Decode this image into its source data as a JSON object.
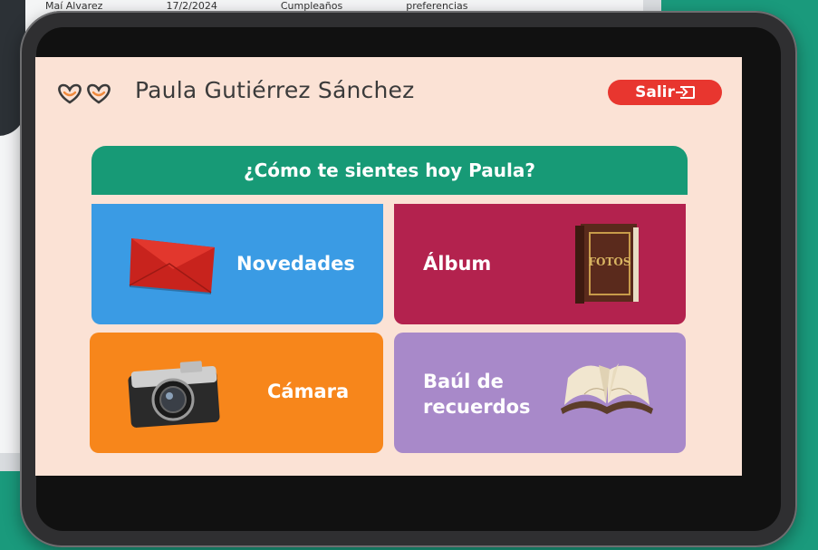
{
  "background_device": {
    "row": [
      "Maí Alvarez",
      "17/2/2024",
      "Cumpleaños",
      "preferencias"
    ]
  },
  "app": {
    "user_name": "Paula Gutiérrez Sánchez",
    "logout_label": "Salir",
    "question": "¿Cómo te sientes hoy Paula?"
  },
  "tiles": [
    {
      "id": "news",
      "label": "Novedades",
      "icon": "envelope-icon",
      "color": "#3a9be4"
    },
    {
      "id": "album",
      "label": "Álbum",
      "icon": "photo-album-icon",
      "color": "#b3224e",
      "icon_text": "FOTOS"
    },
    {
      "id": "camera",
      "label": "Cámara",
      "icon": "camera-icon",
      "color": "#f7861b"
    },
    {
      "id": "memories",
      "label_line1": "Baúl de",
      "label_line2": "recuerdos",
      "icon": "open-book-icon",
      "color": "#a889c9"
    }
  ],
  "colors": {
    "page_background": "#1a9a7c",
    "screen_background": "#fbe2d5",
    "banner": "#179a76",
    "logout": "#e8362f",
    "logo_stroke": "#3b3b3b",
    "logo_accent": "#f08a3c"
  }
}
